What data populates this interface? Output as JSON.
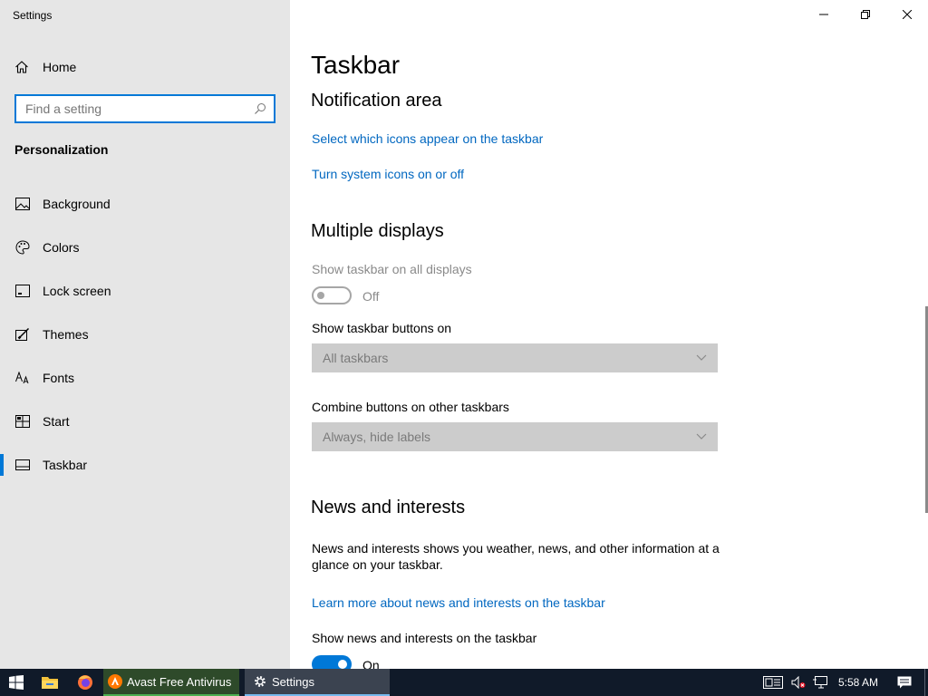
{
  "window": {
    "title": "Settings"
  },
  "sidebar": {
    "home_label": "Home",
    "search_placeholder": "Find a setting",
    "section_title": "Personalization",
    "items": [
      {
        "label": "Background",
        "icon": "image-icon"
      },
      {
        "label": "Colors",
        "icon": "palette-icon"
      },
      {
        "label": "Lock screen",
        "icon": "lock-screen-icon"
      },
      {
        "label": "Themes",
        "icon": "brush-icon"
      },
      {
        "label": "Fonts",
        "icon": "font-icon"
      },
      {
        "label": "Start",
        "icon": "start-icon"
      },
      {
        "label": "Taskbar",
        "icon": "taskbar-icon",
        "active": true
      }
    ]
  },
  "main": {
    "page_title": "Taskbar",
    "notification": {
      "heading": "Notification area",
      "link1": "Select which icons appear on the taskbar",
      "link2": "Turn system icons on or off"
    },
    "multiple_displays": {
      "heading": "Multiple displays",
      "show_all_label": "Show taskbar on all displays",
      "show_all_state": "Off",
      "buttons_on_label": "Show taskbar buttons on",
      "buttons_on_value": "All taskbars",
      "combine_label": "Combine buttons on other taskbars",
      "combine_value": "Always, hide labels"
    },
    "news": {
      "heading": "News and interests",
      "description": "News and interests shows you weather, news, and other information at a glance on your taskbar.",
      "learn_more": "Learn more about news and interests on the taskbar",
      "show_label": "Show news and interests on the taskbar",
      "show_state": "On"
    }
  },
  "taskbar": {
    "apps": [
      {
        "label": "Avast Free Antivirus",
        "icon": "avast-icon"
      },
      {
        "label": "Settings",
        "icon": "gear-icon"
      }
    ],
    "clock": "5:58 AM"
  },
  "colors": {
    "accent": "#0078d7",
    "link": "#0067c0",
    "sidebar_bg": "#e6e6e6",
    "taskbar_bg": "#101a29"
  }
}
